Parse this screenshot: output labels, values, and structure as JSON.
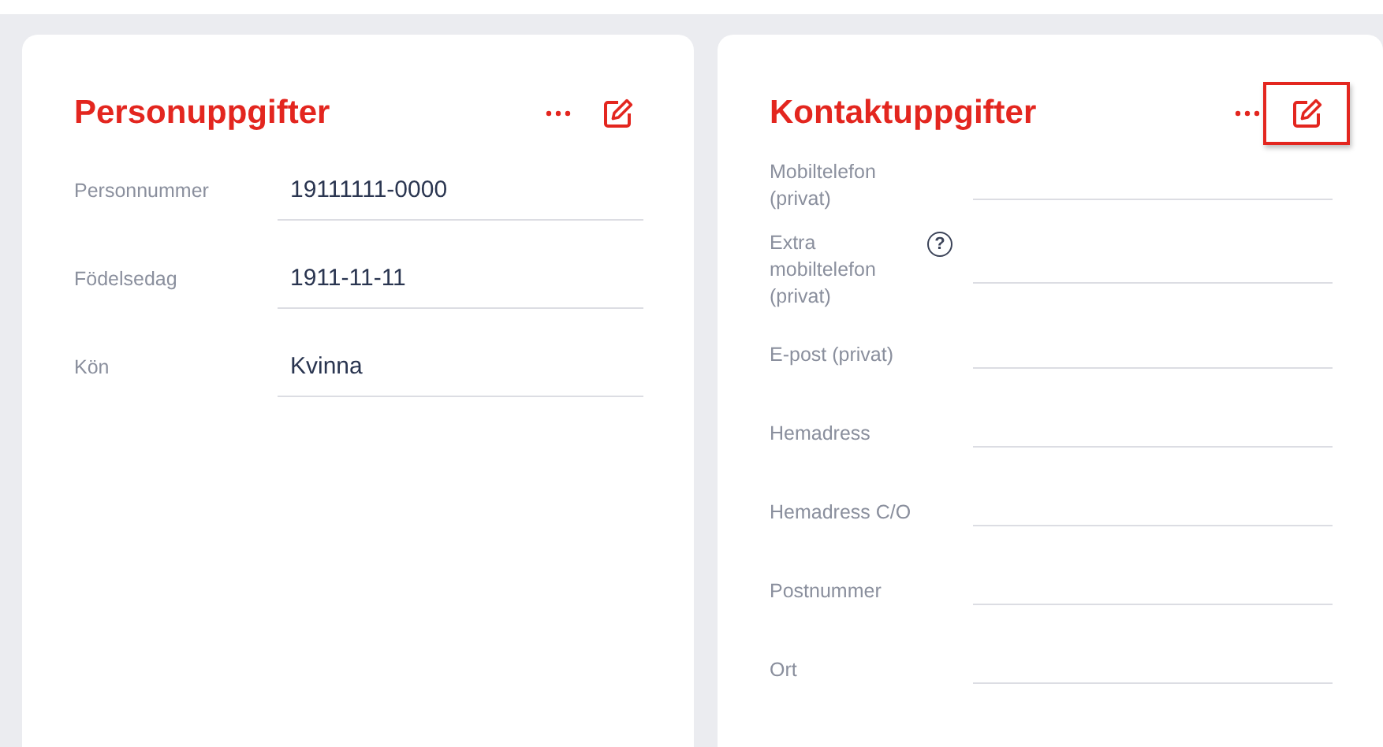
{
  "cards": [
    {
      "title": "Personuppgifter",
      "edit_highlighted": false,
      "fields": [
        {
          "label": "Personnummer",
          "value": "19111111-0000"
        },
        {
          "label": "Födelsedag",
          "value": "1911-11-11"
        },
        {
          "label": "Kön",
          "value": "Kvinna"
        }
      ]
    },
    {
      "title": "Kontaktuppgifter",
      "edit_highlighted": true,
      "fields": [
        {
          "label": "Mobiltelefon (privat)"
        },
        {
          "label": "Extra mobiltelefon (privat)",
          "help_icon": "?"
        },
        {
          "label": "E-post (privat)"
        },
        {
          "label": "Hemadress"
        },
        {
          "label": "Hemadress C/O"
        },
        {
          "label": "Postnummer"
        },
        {
          "label": "Ort"
        }
      ]
    }
  ]
}
